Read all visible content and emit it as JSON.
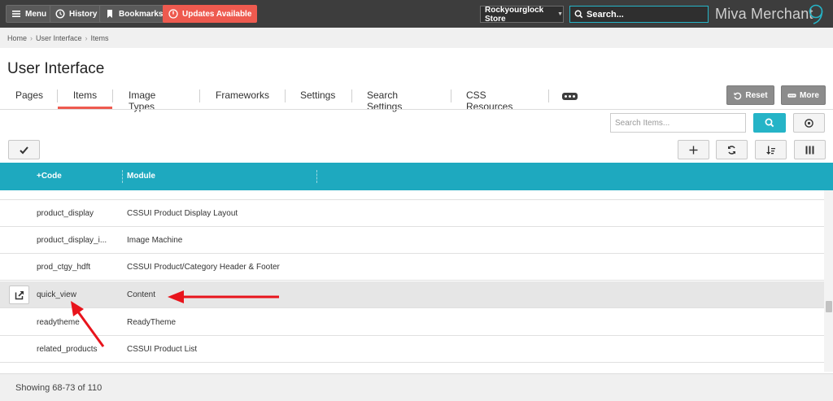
{
  "topbar": {
    "menu_label": "Menu",
    "history_label": "History",
    "bookmarks_label": "Bookmarks",
    "updates_label": "Updates Available",
    "store_name": "Rockyourglock Store",
    "search_placeholder": "Search...",
    "brand": "Miva Merchant"
  },
  "breadcrumb": [
    "Home",
    "User Interface",
    "Items"
  ],
  "page_title": "User Interface",
  "tabs": [
    {
      "label": "Pages"
    },
    {
      "label": "Items",
      "active": true
    },
    {
      "label": "Image Types"
    },
    {
      "label": "Frameworks"
    },
    {
      "label": "Settings"
    },
    {
      "label": "Search Settings"
    },
    {
      "label": "CSS Resources"
    }
  ],
  "actions": {
    "reset_label": "Reset",
    "more_label": "More"
  },
  "items_search": {
    "placeholder": "Search Items..."
  },
  "grid": {
    "columns": [
      "+Code",
      "Module"
    ],
    "rows": [
      {
        "code": "product_display",
        "module": "CSSUI Product Display Layout"
      },
      {
        "code": "product_display_i...",
        "module": "Image Machine"
      },
      {
        "code": "prod_ctgy_hdft",
        "module": "CSSUI Product/Category Header & Footer"
      },
      {
        "code": "quick_view",
        "module": "Content",
        "selected": true
      },
      {
        "code": "readytheme",
        "module": "ReadyTheme"
      },
      {
        "code": "related_products",
        "module": "CSSUI Product List"
      }
    ]
  },
  "footer": {
    "showing": "Showing 68-73 of 110"
  },
  "colors": {
    "accent": "#1ea9bf",
    "alert": "#ee5a4f",
    "annotation": "#e8141c"
  }
}
